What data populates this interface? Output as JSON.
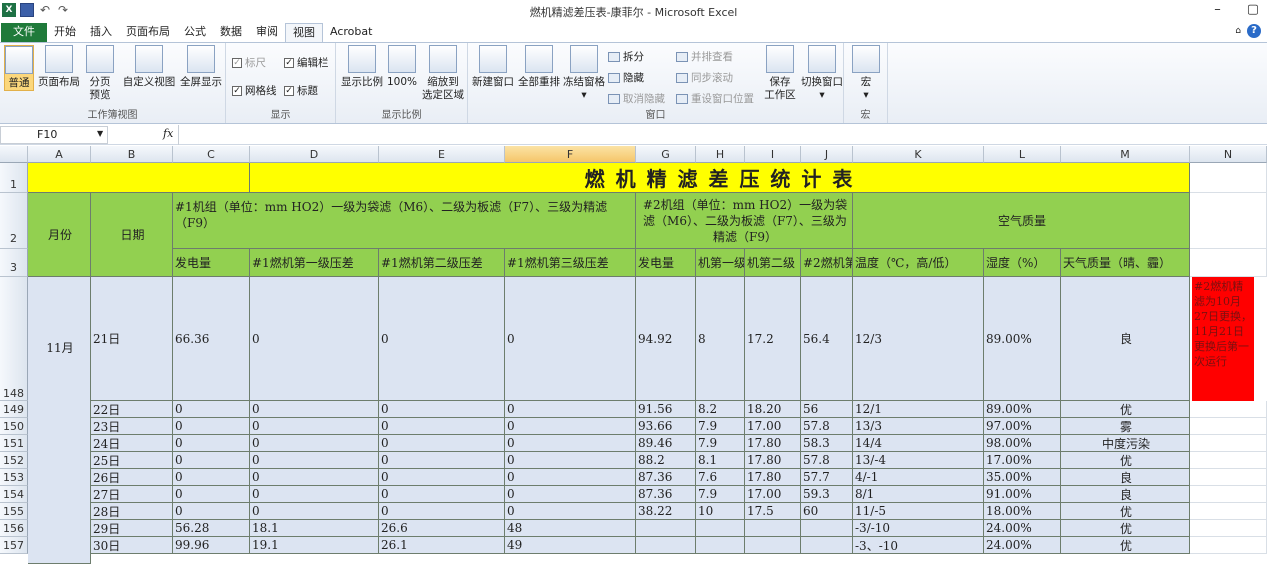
{
  "window": {
    "title": "燃机精滤差压表-康菲尔 - Microsoft Excel",
    "minimize": "–",
    "restore": "▢"
  },
  "tabs": [
    "开始",
    "插入",
    "页面布局",
    "公式",
    "数据",
    "审阅",
    "视图",
    "Acrobat"
  ],
  "file_tab": "文件",
  "ribbon": {
    "workbook_views": {
      "normal": "普通",
      "page_layout": "页面布局",
      "page_break_1": "分页",
      "page_break_2": "预览",
      "custom": "自定义视图",
      "fullscreen": "全屏显示",
      "label": "工作簿视图"
    },
    "show": {
      "ruler": "标尺",
      "formula_bar": "编辑栏",
      "gridlines": "网格线",
      "headings": "标题",
      "label": "显示"
    },
    "zoom": {
      "zoom": "显示比例",
      "hundred": "100%",
      "sel_1": "缩放到",
      "sel_2": "选定区域",
      "label": "显示比例"
    },
    "window": {
      "new": "新建窗口",
      "arrange": "全部重排",
      "freeze": "冻结窗格",
      "split": "拆分",
      "hide": "隐藏",
      "unhide": "取消隐藏",
      "side": "并排查看",
      "sync": "同步滚动",
      "reset": "重设窗口位置",
      "save_1": "保存",
      "save_2": "工作区",
      "switch": "切换窗口",
      "label": "窗口"
    },
    "macros": {
      "macro": "宏",
      "label": "宏"
    }
  },
  "formula_bar": {
    "name_box": "F10",
    "fx": "fx",
    "value": ""
  },
  "columns": [
    "A",
    "B",
    "C",
    "D",
    "E",
    "F",
    "G",
    "H",
    "I",
    "J",
    "K",
    "L",
    "M",
    "N"
  ],
  "selected_column": "F",
  "rows": {
    "r1": "1",
    "r2": "2",
    "r3": "3",
    "r148": "148"
  },
  "title": "燃  机  精  滤  差  压  统  计  表",
  "headers": {
    "month": "月份",
    "date": "日期",
    "unit1": "#1机组（单位：mm HO2）一级为袋滤（M6）、二级为板滤（F7）、三级为精滤（F9）",
    "unit2": "#2机组（单位：mm HO2）一级为袋滤（M6）、二级为板滤（F7）、三级为精滤（F9）",
    "air": "空气质量",
    "c_power": "发电量",
    "d_stage1": "#1燃机第一级压差",
    "e_stage2": "#1燃机第二级压差",
    "f_stage3": "#1燃机第三级压差",
    "g_power": "发电量",
    "h_stage1": "机第一级",
    "i_stage2": "机第二级",
    "j_stage3": "#2燃机第",
    "k_temp": "温度（℃，高/低）",
    "l_humid": "湿度（%）",
    "m_weather": "天气质量（晴、霾）"
  },
  "month_value": "11月",
  "note": "#2燃机精滤为10月27日更换，11月21日更换后第一次运行",
  "data_rows": [
    {
      "row": "148",
      "date": "21日",
      "c": "66.36",
      "d": "0",
      "e": "0",
      "f": "0",
      "g": "94.92",
      "h": "8",
      "i": "17.2",
      "j": "56.4",
      "k": "12/3",
      "l": "89.00%",
      "m": "良"
    },
    {
      "row": "149",
      "date": "22日",
      "c": "0",
      "d": "0",
      "e": "0",
      "f": "0",
      "g": "91.56",
      "h": "8.2",
      "i": "18.20",
      "j": "56",
      "k": "12/1",
      "l": "89.00%",
      "m": "优"
    },
    {
      "row": "150",
      "date": "23日",
      "c": "0",
      "d": "0",
      "e": "0",
      "f": "0",
      "g": "93.66",
      "h": "7.9",
      "i": "17.00",
      "j": "57.8",
      "k": "13/3",
      "l": "97.00%",
      "m": "雾"
    },
    {
      "row": "151",
      "date": "24日",
      "c": "0",
      "d": "0",
      "e": "0",
      "f": "0",
      "g": "89.46",
      "h": "7.9",
      "i": "17.80",
      "j": "58.3",
      "k": "14/4",
      "l": "98.00%",
      "m": "中度污染"
    },
    {
      "row": "152",
      "date": "25日",
      "c": "0",
      "d": "0",
      "e": "0",
      "f": "0",
      "g": "88.2",
      "h": "8.1",
      "i": "17.80",
      "j": "57.8",
      "k": "13/-4",
      "l": "17.00%",
      "m": "优"
    },
    {
      "row": "153",
      "date": "26日",
      "c": "0",
      "d": "0",
      "e": "0",
      "f": "0",
      "g": "87.36",
      "h": "7.6",
      "i": "17.80",
      "j": "57.7",
      "k": "4/-1",
      "l": "35.00%",
      "m": "良"
    },
    {
      "row": "154",
      "date": "27日",
      "c": "0",
      "d": "0",
      "e": "0",
      "f": "0",
      "g": "87.36",
      "h": "7.9",
      "i": "17.00",
      "j": "59.3",
      "k": "8/1",
      "l": "91.00%",
      "m": "良"
    },
    {
      "row": "155",
      "date": "28日",
      "c": "0",
      "d": "0",
      "e": "0",
      "f": "0",
      "g": "38.22",
      "h": "10",
      "i": "17.5",
      "j": "60",
      "k": "11/-5",
      "l": "18.00%",
      "m": "优"
    },
    {
      "row": "156",
      "date": "29日",
      "c": "56.28",
      "d": "18.1",
      "e": "26.6",
      "f": "48",
      "g": "",
      "h": "",
      "i": "",
      "j": "",
      "k": "-3/-10",
      "l": "24.00%",
      "m": "优"
    },
    {
      "row": "157",
      "date": "30日",
      "c": "99.96",
      "d": "19.1",
      "e": "26.1",
      "f": "49",
      "g": "",
      "h": "",
      "i": "",
      "j": "",
      "k": "-3、-10",
      "l": "24.00%",
      "m": "优"
    }
  ]
}
